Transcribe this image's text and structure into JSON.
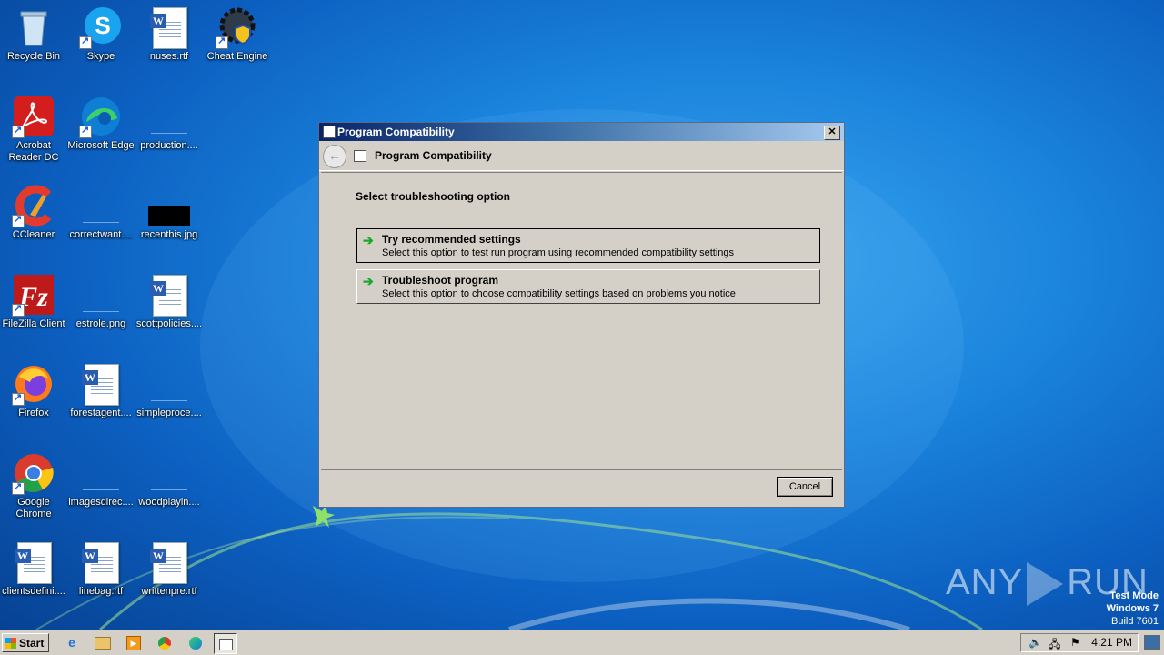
{
  "desktop": {
    "icons": [
      {
        "label": "Recycle Bin",
        "icon": "recycle-bin-icon"
      },
      {
        "label": "Skype",
        "icon": "skype-icon"
      },
      {
        "label": "nuses.rtf",
        "icon": "word-doc-icon"
      },
      {
        "label": "Cheat Engine",
        "icon": "cheat-engine-icon"
      },
      {
        "label": "Acrobat Reader DC",
        "icon": "acrobat-icon"
      },
      {
        "label": "Microsoft Edge",
        "icon": "edge-icon"
      },
      {
        "label": "production....",
        "icon": "file-icon"
      },
      {
        "label": "CCleaner",
        "icon": "ccleaner-icon"
      },
      {
        "label": "correctwant....",
        "icon": "file-icon"
      },
      {
        "label": "recenthis.jpg",
        "icon": "image-icon"
      },
      {
        "label": "FileZilla Client",
        "icon": "filezilla-icon"
      },
      {
        "label": "estrole.png",
        "icon": "file-icon"
      },
      {
        "label": "scottpolicies....",
        "icon": "word-doc-icon"
      },
      {
        "label": "Firefox",
        "icon": "firefox-icon"
      },
      {
        "label": "forestagent....",
        "icon": "word-doc-icon"
      },
      {
        "label": "simpleproce....",
        "icon": "file-icon"
      },
      {
        "label": "Google Chrome",
        "icon": "chrome-icon"
      },
      {
        "label": "imagesdirec....",
        "icon": "file-icon"
      },
      {
        "label": "woodplayin....",
        "icon": "file-icon"
      },
      {
        "label": "clientsdefini....",
        "icon": "word-doc-icon"
      },
      {
        "label": "linebag.rtf",
        "icon": "word-doc-icon"
      },
      {
        "label": "writtenpre.rtf",
        "icon": "word-doc-icon"
      }
    ]
  },
  "dialog": {
    "window_title": "Program Compatibility",
    "nav_title": "Program Compatibility",
    "heading": "Select troubleshooting option",
    "options": [
      {
        "title": "Try recommended settings",
        "desc": "Select this option to test run program using recommended compatibility settings"
      },
      {
        "title": "Troubleshoot program",
        "desc": "Select this option to choose compatibility settings based on problems you notice"
      }
    ],
    "cancel_label": "Cancel",
    "close_glyph": "✕",
    "back_glyph": "←"
  },
  "watermark": {
    "brand_left": "ANY",
    "brand_right": "RUN",
    "mode": "Test Mode",
    "os": "Windows 7",
    "build": "Build 7601"
  },
  "taskbar": {
    "start_label": "Start",
    "clock": "4:21 PM",
    "pinned": [
      "internet-explorer-icon",
      "explorer-icon",
      "media-player-icon",
      "chrome-icon",
      "edge-icon",
      "program-compatibility-icon"
    ]
  }
}
